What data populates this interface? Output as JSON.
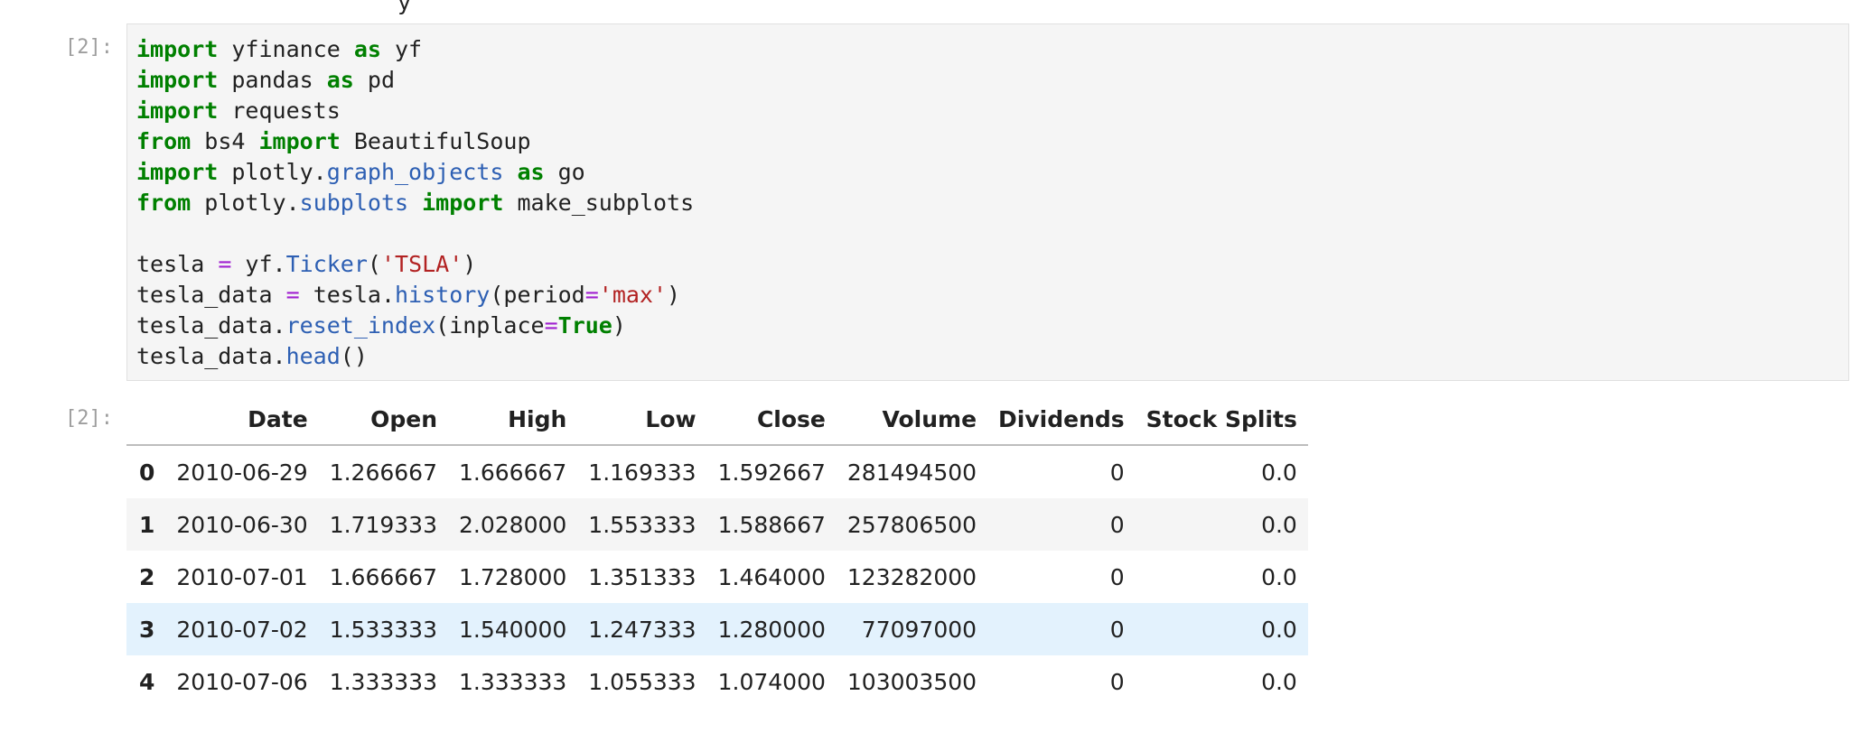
{
  "partial_top": "y",
  "in_prompt": "[2]:",
  "out_prompt": "[2]:",
  "code_lines": [
    [
      {
        "t": "import",
        "c": "kw"
      },
      {
        "t": " yfinance "
      },
      {
        "t": "as",
        "c": "kw"
      },
      {
        "t": " yf"
      }
    ],
    [
      {
        "t": "import",
        "c": "kw"
      },
      {
        "t": " pandas "
      },
      {
        "t": "as",
        "c": "kw"
      },
      {
        "t": " pd"
      }
    ],
    [
      {
        "t": "import",
        "c": "kw"
      },
      {
        "t": " requests"
      }
    ],
    [
      {
        "t": "from",
        "c": "kw"
      },
      {
        "t": " bs4 "
      },
      {
        "t": "import",
        "c": "kw"
      },
      {
        "t": " BeautifulSoup"
      }
    ],
    [
      {
        "t": "import",
        "c": "kw"
      },
      {
        "t": " plotly."
      },
      {
        "t": "graph_objects",
        "c": "attr"
      },
      {
        "t": " "
      },
      {
        "t": "as",
        "c": "kw"
      },
      {
        "t": " go"
      }
    ],
    [
      {
        "t": "from",
        "c": "kw"
      },
      {
        "t": " plotly."
      },
      {
        "t": "subplots",
        "c": "attr"
      },
      {
        "t": " "
      },
      {
        "t": "import",
        "c": "kw"
      },
      {
        "t": " make_subplots"
      }
    ],
    [],
    [
      {
        "t": "tesla "
      },
      {
        "t": "=",
        "c": "op"
      },
      {
        "t": " yf."
      },
      {
        "t": "Ticker",
        "c": "attr"
      },
      {
        "t": "("
      },
      {
        "t": "'TSLA'",
        "c": "str"
      },
      {
        "t": ")"
      }
    ],
    [
      {
        "t": "tesla_data "
      },
      {
        "t": "=",
        "c": "op"
      },
      {
        "t": " tesla."
      },
      {
        "t": "history",
        "c": "attr"
      },
      {
        "t": "(period"
      },
      {
        "t": "=",
        "c": "op"
      },
      {
        "t": "'max'",
        "c": "str"
      },
      {
        "t": ")"
      }
    ],
    [
      {
        "t": "tesla_data."
      },
      {
        "t": "reset_index",
        "c": "attr"
      },
      {
        "t": "(inplace"
      },
      {
        "t": "=",
        "c": "op"
      },
      {
        "t": "True",
        "c": "kw"
      },
      {
        "t": ")"
      }
    ],
    [
      {
        "t": "tesla_data."
      },
      {
        "t": "head",
        "c": "attr"
      },
      {
        "t": "()"
      }
    ]
  ],
  "table": {
    "columns": [
      "",
      "Date",
      "Open",
      "High",
      "Low",
      "Close",
      "Volume",
      "Dividends",
      "Stock Splits"
    ],
    "rows": [
      [
        "0",
        "2010-06-29",
        "1.266667",
        "1.666667",
        "1.169333",
        "1.592667",
        "281494500",
        "0",
        "0.0"
      ],
      [
        "1",
        "2010-06-30",
        "1.719333",
        "2.028000",
        "1.553333",
        "1.588667",
        "257806500",
        "0",
        "0.0"
      ],
      [
        "2",
        "2010-07-01",
        "1.666667",
        "1.728000",
        "1.351333",
        "1.464000",
        "123282000",
        "0",
        "0.0"
      ],
      [
        "3",
        "2010-07-02",
        "1.533333",
        "1.540000",
        "1.247333",
        "1.280000",
        "77097000",
        "0",
        "0.0"
      ],
      [
        "4",
        "2010-07-06",
        "1.333333",
        "1.333333",
        "1.055333",
        "1.074000",
        "103003500",
        "0",
        "0.0"
      ]
    ],
    "hover_row": 3
  }
}
